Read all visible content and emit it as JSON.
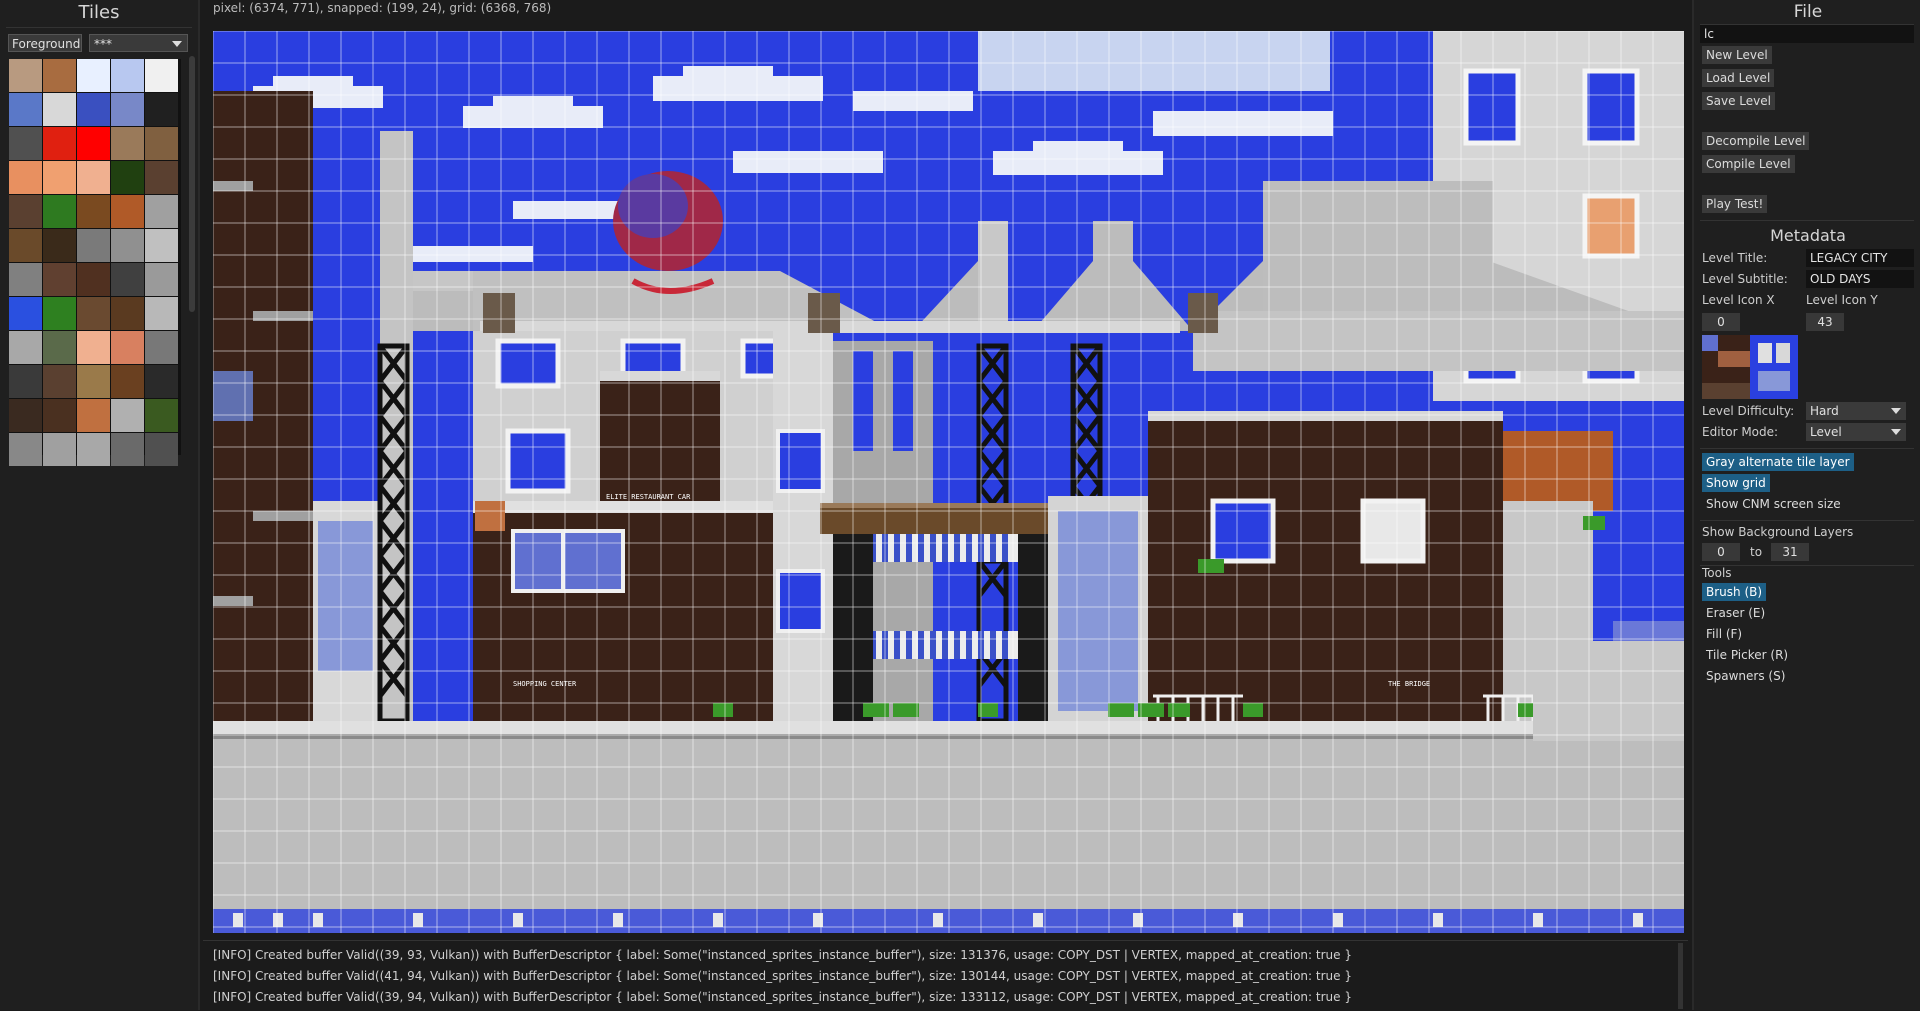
{
  "tiles_panel": {
    "title": "Tiles",
    "layer_value": "Foreground",
    "tileset_value": "***",
    "tile_colors": [
      "#b89a80",
      "#a86c40",
      "#e8f0ff",
      "#b8c8f0",
      "#f0f0f0",
      "#5a78c8",
      "#d8d8d8",
      "#3a50c0",
      "#7888c8",
      "#202020",
      "#505050",
      "#e02010",
      "#ff0000",
      "#9a7a5a",
      "#806040",
      "#e89060",
      "#f0a070",
      "#f0b090",
      "#204010",
      "#5a4030",
      "#5a4030",
      "#2e7a20",
      "#7a4a20",
      "#b05a28",
      "#a0a0a0",
      "#6a4a2a",
      "#3a2a1a",
      "#7a7a7a",
      "#909090",
      "#c0c0c0",
      "#808080",
      "#604030",
      "#503020",
      "#404040",
      "#9a9a9a",
      "#2a50e0",
      "#2e8020",
      "#6a4a30",
      "#5a3a20",
      "#b8b8b8",
      "#a8a8a8",
      "#5a6a4a",
      "#f0b090",
      "#d88060",
      "#787878",
      "#3a3a3a",
      "#5a4030",
      "#9a7a4a",
      "#6a4020",
      "#2a2a2a",
      "#3a2a20",
      "#4a3020",
      "#c07040",
      "#b0b0b0",
      "#3a5a20",
      "#888888",
      "#a0a0a0",
      "#a8a8a8",
      "#6a6a6a",
      "#505050"
    ]
  },
  "status": {
    "text": "pixel: (6374, 771), snapped: (199, 24), grid: (6368, 768)"
  },
  "level_view": {
    "sky_color": "#2a3ee0",
    "ground_color": "#bdbdbd",
    "building_gray": "#c8c8c8",
    "brick_color": "#3a2218",
    "sign_labels": [
      "ELITE RESTAURANT CAR",
      "SHOPPING CENTER",
      "THE BRIDGE"
    ]
  },
  "log": {
    "lines": [
      "[INFO] Created buffer Valid((39, 93, Vulkan)) with BufferDescriptor { label: Some(\"instanced_sprites_instance_buffer\"), size: 131376, usage: COPY_DST | VERTEX, mapped_at_creation: true }",
      "[INFO] Created buffer Valid((41, 94, Vulkan)) with BufferDescriptor { label: Some(\"instanced_sprites_instance_buffer\"), size: 130144, usage: COPY_DST | VERTEX, mapped_at_creation: true }",
      "[INFO] Created buffer Valid((39, 94, Vulkan)) with BufferDescriptor { label: Some(\"instanced_sprites_instance_buffer\"), size: 133112, usage: COPY_DST | VERTEX, mapped_at_creation: true }"
    ]
  },
  "right_panel": {
    "file_title": "File",
    "file_input": "lc",
    "buttons": {
      "new_level": "New Level",
      "load_level": "Load Level",
      "save_level": "Save Level",
      "decompile_level": "Decompile Level",
      "compile_level": "Compile Level",
      "play_test": "Play Test!"
    },
    "metadata_title": "Metadata",
    "level_title_label": "Level Title:",
    "level_title_value": "LEGACY CITY",
    "level_subtitle_label": "Level Subtitle:",
    "level_subtitle_value": "OLD DAYS",
    "level_icon_x_label": "Level Icon X",
    "level_icon_y_label": "Level Icon Y",
    "level_icon_x_value": "0",
    "level_icon_y_value": "43",
    "level_difficulty_label": "Level Difficulty:",
    "level_difficulty_value": "Hard",
    "editor_mode_label": "Editor Mode:",
    "editor_mode_value": "Level",
    "toggles": {
      "gray_alternate": "Gray alternate tile layer",
      "show_grid": "Show grid",
      "show_cnm": "Show CNM screen size"
    },
    "bg_layers_label": "Show Background Layers",
    "bg_from": "0",
    "bg_to_label": "to",
    "bg_to": "31",
    "tools_label": "Tools",
    "tools": {
      "brush": "Brush (B)",
      "eraser": "Eraser (E)",
      "fill": "Fill (F)",
      "tile_picker": "Tile Picker (R)",
      "spawners": "Spawners (S)"
    }
  }
}
